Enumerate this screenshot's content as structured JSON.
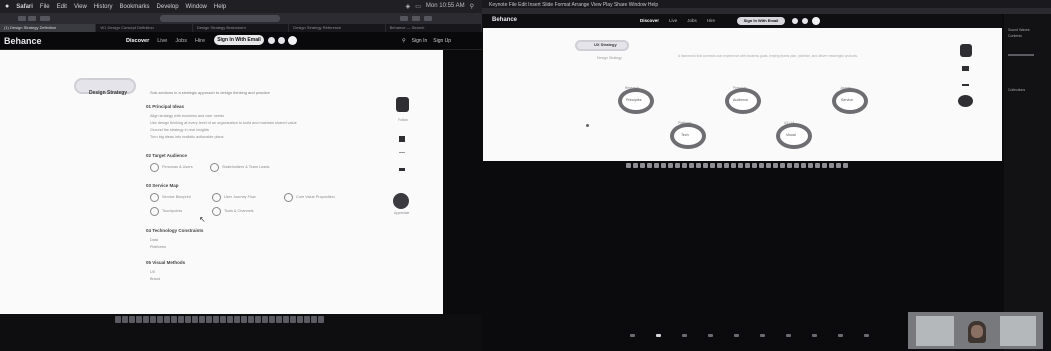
{
  "left": {
    "menubar": {
      "items": [
        "Safari",
        "File",
        "Edit",
        "View",
        "History",
        "Bookmarks",
        "Develop",
        "Window",
        "Help"
      ],
      "status": [
        "Mon 10:55 AM"
      ]
    },
    "tabs": [
      "(1) Design Strategy Definition",
      "W1 Design Concept Definition",
      "Design Strategy Brainstorm",
      "Design Strategy Reference",
      "Behance — Search"
    ],
    "site": {
      "brand": "Behance",
      "nav": [
        "Discover",
        "Live",
        "Jobs",
        "Hire"
      ],
      "nav_strong": "Discover",
      "signup": "Sign In With Email",
      "right_nav": [
        "Sign In",
        "Sign Up"
      ]
    },
    "logo_text": "Design Strategy",
    "intro": "Sub-sections in a strategic approach to design thinking and practice",
    "sections": [
      {
        "title": "01   Principal Ideas",
        "lines": [
          "Align strategy with business and user needs",
          "Use design thinking at every level of an organization to build and maintain shared value",
          "Ground the strategy in real insights",
          "Turn big ideas into realistic actionable plans"
        ]
      },
      {
        "title": "02   Target Audience",
        "items": [
          "Personas & Users",
          "Stakeholders & Team Leads"
        ]
      },
      {
        "title": "03   Service Map",
        "items": [
          "Service Blueprint",
          "User Journey Flow",
          "Core Value Proposition",
          "Touchpoints",
          "Tools & Channels"
        ]
      },
      {
        "title": "04   Technology Constraints",
        "lines": [
          "Data",
          "Platforms"
        ]
      },
      {
        "title": "05   Visual Methods",
        "lines": [
          "UX",
          "Brand"
        ]
      }
    ],
    "side_labels": [
      "Follow",
      "Save",
      "Appreciate"
    ]
  },
  "right": {
    "menubar": "Keynote   File   Edit   Insert   Slide   Format   Arrange   View   Play   Share   Window   Help",
    "site": {
      "brand": "Behance",
      "nav": [
        "Discover",
        "Live",
        "Jobs",
        "Hire"
      ],
      "nav_strong": "Discover",
      "signup": "Sign In With Email"
    },
    "logo_text": "UX Strategy",
    "subtitle": "Design Strategy",
    "paragraph": "A framework that connects user experience with business goals, helping teams plan, prioritize, and deliver meaningful products.",
    "bubbles": [
      {
        "label": "Principles",
        "caption": "Research"
      },
      {
        "label": "Audience",
        "caption": "Personas"
      },
      {
        "label": "Service",
        "caption": "Journey"
      },
      {
        "label": "Tech",
        "caption": "Platforms"
      },
      {
        "label": "Visual",
        "caption": "UX / UI"
      }
    ],
    "side_text": [
      "Sound Waves",
      "Contents",
      "Collections"
    ],
    "page_dots": 10,
    "active_dot": 1
  },
  "colors": {
    "page": "#fafafa",
    "chrome": "#1f1f24",
    "desk": "#0b0b0d"
  }
}
